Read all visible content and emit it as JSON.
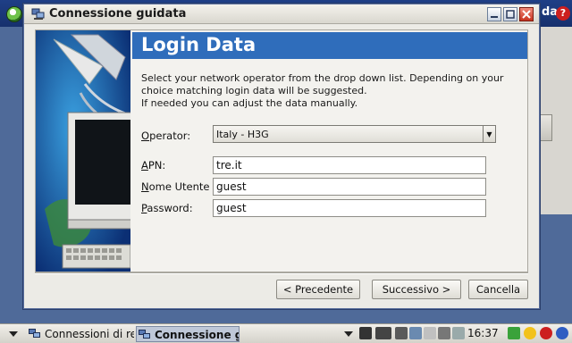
{
  "dialog": {
    "title": "Connessione guidata",
    "header_title": "Login Data",
    "description_lines": [
      "Select your network operator from the drop down list. Depending on your",
      "choice matching login data will be suggested.",
      "If needed you can adjust the data manually."
    ]
  },
  "form": {
    "operator": {
      "label_first": "O",
      "label_rest": "perator:",
      "value": "Italy - H3G"
    },
    "apn": {
      "label_first": "A",
      "label_rest": "PN:",
      "value": "tre.it"
    },
    "username": {
      "label_first": "N",
      "label_rest": "ome Utente",
      "value": "guest"
    },
    "password": {
      "label_first": "P",
      "label_rest": "assword:",
      "value": "guest"
    }
  },
  "buttons": {
    "back": "< Precedente",
    "next": "Successivo >",
    "cancel": "Cancella"
  },
  "background_app": {
    "label": "da",
    "help_icon": "?"
  },
  "taskbar": {
    "items": [
      {
        "label": "Connessioni di ret"
      },
      {
        "label": "Connessione g"
      }
    ],
    "clock": "16:37"
  },
  "colors": {
    "header_banner": "#2f6dbb",
    "desktop": "#1f3f86",
    "close_button": "#c8321f"
  }
}
